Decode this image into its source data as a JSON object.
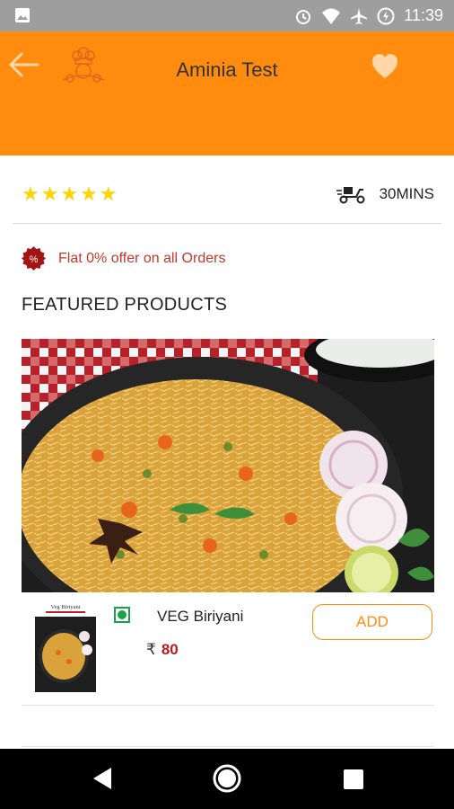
{
  "status_bar": {
    "time": "11:39",
    "icons": [
      "image-icon",
      "alarm-icon",
      "wifi-icon",
      "airplane-icon",
      "battery-charging-icon"
    ]
  },
  "header": {
    "title": "Aminia Test",
    "back_icon": "arrow-left-icon",
    "favorite_icon": "heart-icon",
    "logo_icon": "chef-logo-icon"
  },
  "rating": {
    "stars": 5,
    "star_glyphs": "★★★★★"
  },
  "delivery": {
    "icon": "delivery-scooter-icon",
    "time_label": "30MINS"
  },
  "offer": {
    "badge": "%",
    "text": "Flat 0% offer on all Orders"
  },
  "featured": {
    "section_title": "FEATURED PRODUCTS",
    "products": [
      {
        "name": "VEG Biriyani",
        "currency": "₹",
        "price": "80",
        "add_label": "ADD",
        "thumb_caption": "Veg Biriyani"
      }
    ]
  },
  "colors": {
    "brand": "#ff8c0f",
    "price": "#b71c1c",
    "offer": "#c0392b",
    "star": "#ffd400",
    "veg": "#1aa24a"
  },
  "nav": {
    "icons": [
      "nav-back-icon",
      "nav-home-icon",
      "nav-recents-icon"
    ]
  }
}
